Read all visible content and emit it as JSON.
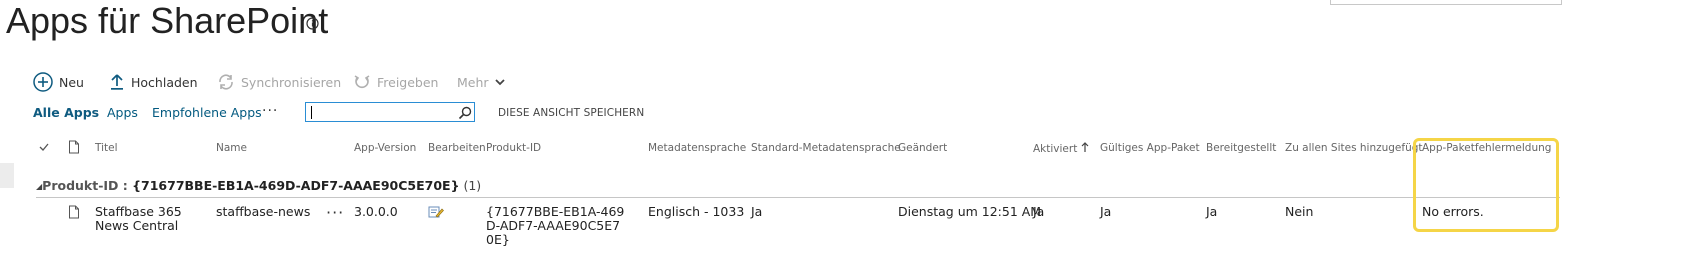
{
  "page": {
    "title": "Apps für SharePoint"
  },
  "toolbar": {
    "new_label": "Neu",
    "upload_label": "Hochladen",
    "sync_label": "Synchronisieren",
    "share_label": "Freigeben",
    "more_label": "Mehr"
  },
  "views": {
    "all_apps": "Alle Apps",
    "apps": "Apps",
    "featured_apps": "Empfohlene Apps",
    "more": "···"
  },
  "search": {
    "value": "",
    "save_view_label": "DIESE ANSICHT SPEICHERN"
  },
  "columns": {
    "title": "Titel",
    "name": "Name",
    "app_version": "App-Version",
    "edit": "Bearbeiten",
    "product_id": "Produkt-ID",
    "metadata_language": "Metadatensprache",
    "default_metadata_language": "Standard-Metadatensprache",
    "modified": "Geändert",
    "activated": "Aktiviert",
    "valid_package": "Gültiges App-Paket",
    "deployed": "Bereitgestellt",
    "added_to_all_sites": "Zu allen Sites hinzugefügt",
    "package_error": "App-Paketfehlermeldung"
  },
  "group": {
    "label": "Produkt-ID",
    "separator": " : ",
    "value": "{71677BBE-EB1A-469D-ADF7-AAAE90C5E70E}",
    "count": "(1)"
  },
  "rows": [
    {
      "title": "Staffbase 365 News Central",
      "name": "staffbase-news",
      "menu": "···",
      "app_version": "3.0.0.0",
      "product_id": "{71677BBE-EB1A-469D-ADF7-AAAE90C5E70E}",
      "metadata_language": "Englisch - 1033",
      "default_metadata_language": "Ja",
      "modified": "Dienstag um 12:51 AM",
      "activated": "Ja",
      "valid_package": "Ja",
      "deployed": "Ja",
      "added_to_all_sites": "Nein",
      "package_error": "No errors."
    }
  ],
  "colors": {
    "accent": "#0f5b80",
    "highlight": "#f5d547",
    "disabled": "#a6a6a6"
  },
  "icons": {
    "new": "plus-circle-icon",
    "upload": "upload-arrow-icon",
    "sync": "sync-icon",
    "share": "share-icon",
    "more": "chevron-down-icon",
    "search": "search-icon",
    "info": "info-icon",
    "sort": "sort-ascending-icon",
    "edit": "edit-icon"
  }
}
